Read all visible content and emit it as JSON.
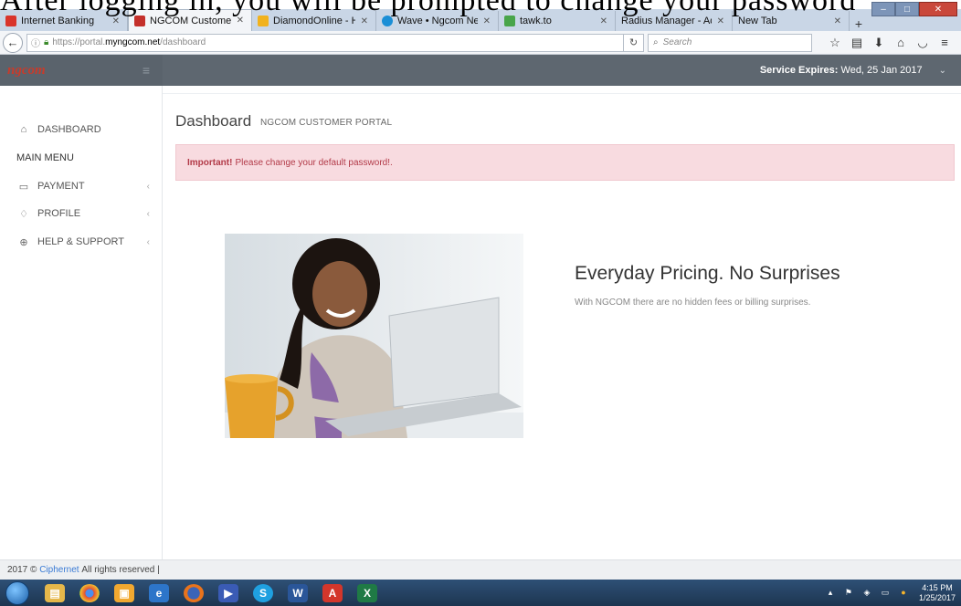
{
  "caption_text": "After logging in, you will be prompted to change your password",
  "browser": {
    "tabs": [
      {
        "label": "Internet Banking",
        "icon": "zenith-icon",
        "color": "#d9342b"
      },
      {
        "label": "NGCOM Customer P...",
        "icon": "ngcom-icon",
        "color": "#c4302b",
        "active": true
      },
      {
        "label": "DiamondOnline - Ho...",
        "icon": "diamond-icon",
        "color": "#f1b21d"
      },
      {
        "label": "Wave • Ngcom Netw...",
        "icon": "wave-icon",
        "color": "#1b8fd6"
      },
      {
        "label": "tawk.to",
        "icon": "tawk-icon",
        "color": "#49a54a"
      },
      {
        "label": "Radius Manager - Admin...",
        "icon": "",
        "color": ""
      },
      {
        "label": "New Tab",
        "icon": "",
        "color": ""
      }
    ],
    "url_prefix": "https://portal.",
    "url_host": "myngcom.net",
    "url_path": "/dashboard",
    "search_placeholder": "Search"
  },
  "header": {
    "logo_text": "ngcom",
    "service_label": "Service Expires:",
    "service_date": "Wed, 25 Jan 2017"
  },
  "sidebar": {
    "dashboard_label": "DASHBOARD",
    "main_menu_label": "MAIN MENU",
    "items": [
      {
        "label": "PAYMENT",
        "icon": "payment-icon"
      },
      {
        "label": "PROFILE",
        "icon": "diamond-profile-icon"
      },
      {
        "label": "HELP & SUPPORT",
        "icon": "lifebuoy-icon"
      }
    ]
  },
  "main": {
    "title": "Dashboard",
    "subtitle": "NGCOM CUSTOMER PORTAL",
    "alert_strong": "Important!",
    "alert_text": "Please change your default password!.",
    "promo_title": "Everyday Pricing. No Surprises",
    "promo_text": "With NGCOM there are no hidden fees or billing surprises."
  },
  "footer": {
    "prefix": "2017 ©",
    "link": "Ciphernet",
    "suffix": "All rights reserved |"
  },
  "taskbar": {
    "time": "4:15 PM",
    "date": "1/25/2017"
  }
}
